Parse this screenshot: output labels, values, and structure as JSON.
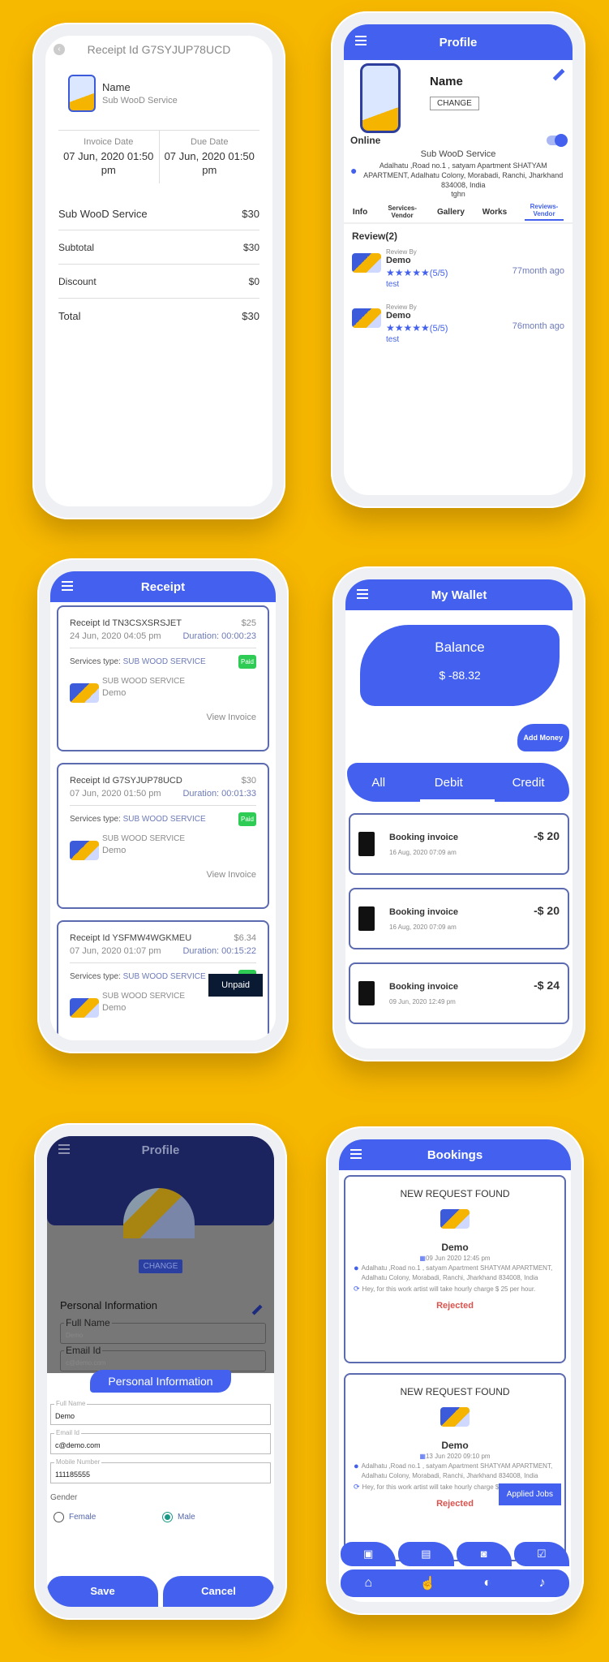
{
  "invoice": {
    "title": "Receipt Id G7SYJUP78UCD",
    "name": "Name",
    "service": "Sub WooD Service",
    "invoice_date_label": "Invoice Date",
    "invoice_date": "07 Jun, 2020 01:50 pm",
    "due_date_label": "Due Date",
    "due_date": "07 Jun, 2020 01:50 pm",
    "lines": [
      {
        "label": "Sub WooD Service",
        "value": "$30"
      },
      {
        "label": "Subtotal",
        "value": "$30"
      },
      {
        "label": "Discount",
        "value": "$0"
      },
      {
        "label": "Total",
        "value": "$30"
      }
    ]
  },
  "profile": {
    "title": "Profile",
    "name": "Name",
    "change_label": "CHANGE",
    "online_label": "Online",
    "online": true,
    "service": "Sub WooD Service",
    "address": "Adalhatu ,Road no.1 , satyam Apartment SHATYAM APARTMENT, Adalhatu Colony, Morabadi, Ranchi, Jharkhand 834008, India",
    "note": "tghn",
    "tabs": [
      "Info",
      "Services-Vendor",
      "Gallery",
      "Works",
      "Reviews-Vendor"
    ],
    "active_tab": "Reviews-Vendor",
    "review_heading": "Review(2)",
    "reviews": [
      {
        "by_label": "Review By",
        "name": "Demo",
        "rating": "(5/5)",
        "stars": 5,
        "text": "test",
        "ago": "77month ago"
      },
      {
        "by_label": "Review By",
        "name": "Demo",
        "rating": "(5/5)",
        "stars": 5,
        "text": "test",
        "ago": "76month ago"
      }
    ]
  },
  "receipts": {
    "title": "Receipt",
    "services_type_label": "Services type:",
    "view_invoice_label": "View Invoice",
    "items": [
      {
        "id": "Receipt Id TN3CSXSRSJET",
        "amount": "$25",
        "date": "24 Jun, 2020 04:05 pm",
        "duration": "Duration: 00:00:23",
        "service_type": "SUB WOOD SERVICE",
        "status": "Paid",
        "service": "SUB WOOD SERVICE",
        "customer": "Demo"
      },
      {
        "id": "Receipt Id G7SYJUP78UCD",
        "amount": "$30",
        "date": "07 Jun, 2020 01:50 pm",
        "duration": "Duration: 00:01:33",
        "service_type": "SUB WOOD SERVICE",
        "status": "Paid",
        "service": "SUB WOOD SERVICE",
        "customer": "Demo"
      },
      {
        "id": "Receipt Id YSFMW4WGKMEU",
        "amount": "$6.34",
        "date": "07 Jun, 2020 01:07 pm",
        "duration": "Duration: 00:15:22",
        "service_type": "SUB WOOD SERVICE",
        "status": "Paid",
        "service": "SUB WOOD SERVICE",
        "customer": "Demo"
      }
    ],
    "toast": "Unpaid"
  },
  "wallet": {
    "title": "My Wallet",
    "balance_label": "Balance",
    "balance": "$ -88.32",
    "add_money_label": "Add Money",
    "tabs": [
      "All",
      "Debit",
      "Credit"
    ],
    "active_tab": "Debit",
    "transactions": [
      {
        "title": "Booking invoice",
        "date": "16 Aug, 2020 07:09 am",
        "amount": "-$ 20"
      },
      {
        "title": "Booking invoice",
        "date": "16 Aug, 2020 07:09 am",
        "amount": "-$ 20"
      },
      {
        "title": "Booking invoice",
        "date": "09 Jun, 2020 12:49 pm",
        "amount": "-$ 24"
      }
    ]
  },
  "edit_profile": {
    "title": "Profile",
    "change_label": "CHANGE",
    "section_label": "Personal Information",
    "bg_fields": [
      {
        "label": "Full Name",
        "value": "Demo"
      },
      {
        "label": "Email Id",
        "value": "c@demo.com"
      }
    ],
    "sheet_title": "Personal Information",
    "fields": [
      {
        "label": "Full Name",
        "value": "Demo"
      },
      {
        "label": "Email Id",
        "value": "c@demo.com"
      },
      {
        "label": "Mobile Number",
        "value": "111185555"
      }
    ],
    "gender_label": "Gender",
    "gender_options": [
      "Female",
      "Male"
    ],
    "gender_selected": "Male",
    "save_label": "Save",
    "cancel_label": "Cancel"
  },
  "bookings": {
    "title": "Bookings",
    "items": [
      {
        "heading": "NEW REQUEST FOUND",
        "name": "Demo",
        "date": "09 Jun 2020 12:45 pm",
        "address": "Adalhatu ,Road no.1 , satyam Apartment SHATYAM APARTMENT, Adalhatu Colony, Morabadi, Ranchi, Jharkhand 834008, India",
        "note": "Hey, for this work artist will take hourly charge $ 25 per hour.",
        "status": "Rejected"
      },
      {
        "heading": "NEW REQUEST FOUND",
        "name": "Demo",
        "date": "13 Jun 2020 09:10 pm",
        "address": "Adalhatu ,Road no.1 , satyam Apartment SHATYAM APARTMENT, Adalhatu Colony, Morabadi, Ranchi, Jharkhand 834008, India",
        "note": "Hey, for this work artist will take hourly charge $ 25 per hour.",
        "status": "Rejected"
      }
    ],
    "toast": "Applied Jobs",
    "sub_nav": [
      "pending-jobs-icon",
      "accepted-jobs-icon",
      "rejected-jobs-icon",
      "completed-jobs-icon"
    ],
    "bottom_nav": [
      "home-icon",
      "jobs-icon",
      "chat-icon",
      "notification-icon"
    ]
  },
  "colors": {
    "brand": "#4361ee",
    "background": "#f7b800",
    "paid": "#2ecc55",
    "rejected": "#d9534f"
  }
}
